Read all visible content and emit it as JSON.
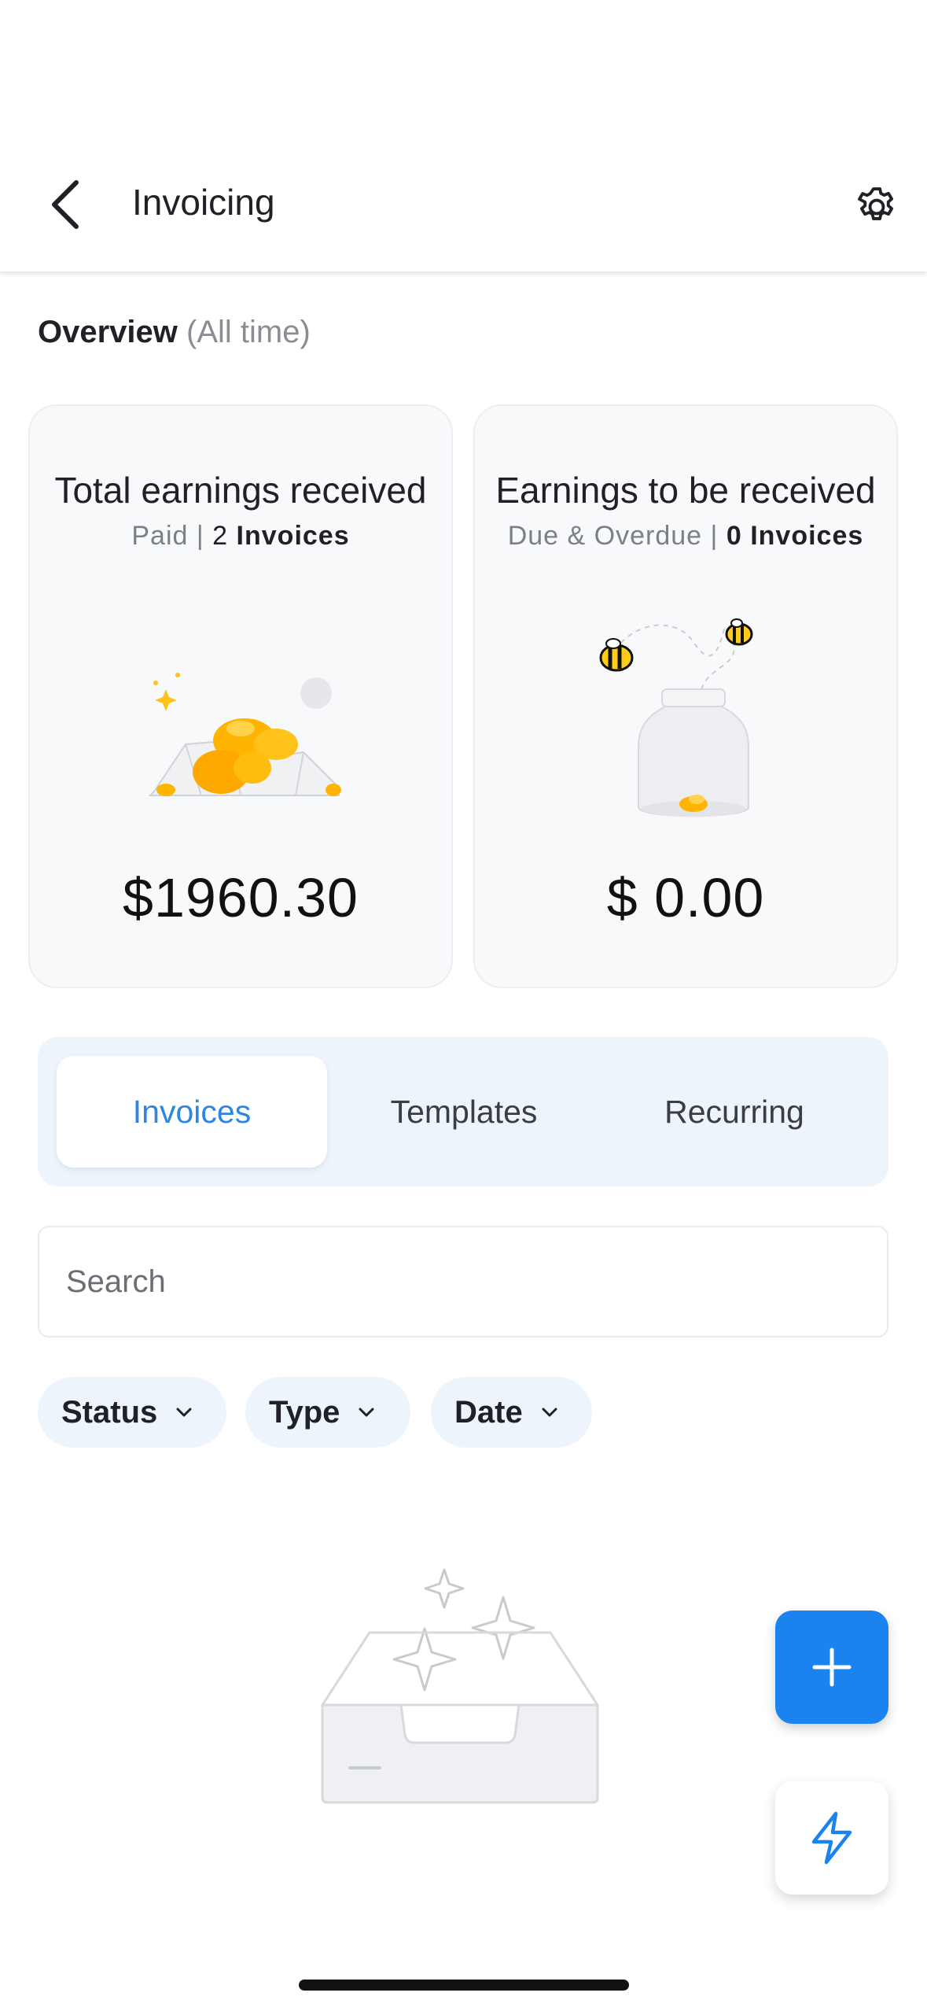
{
  "header": {
    "title": "Invoicing",
    "back_icon": "chevron-left-icon",
    "settings_icon": "gear-icon"
  },
  "overview": {
    "label": "Overview",
    "range": "(All time)"
  },
  "cards": [
    {
      "title": "Total earnings received",
      "status": "Paid",
      "separator": "|",
      "count": "2",
      "count_label": "Invoices",
      "amount": "$1960.30",
      "illustration": "gold-coins-icon"
    },
    {
      "title": "Earnings to be received",
      "status": "Due & Overdue",
      "separator": "|",
      "count": "0",
      "count_label": "Invoices",
      "amount": "$ 0.00",
      "illustration": "bees-jar-icon"
    }
  ],
  "tabs": [
    {
      "label": "Invoices",
      "active": true
    },
    {
      "label": "Templates",
      "active": false
    },
    {
      "label": "Recurring",
      "active": false
    }
  ],
  "search": {
    "placeholder": "Search",
    "value": ""
  },
  "filters": [
    {
      "label": "Status"
    },
    {
      "label": "Type"
    },
    {
      "label": "Date"
    }
  ],
  "empty_state": {
    "illustration": "empty-inbox-icon"
  },
  "fabs": {
    "add_icon": "plus-icon",
    "quick_icon": "lightning-icon"
  },
  "colors": {
    "accent": "#1b83f0",
    "active_tab_text": "#2f86e0",
    "tab_bg": "#eef4fc",
    "card_bg": "#f8f9fb"
  }
}
